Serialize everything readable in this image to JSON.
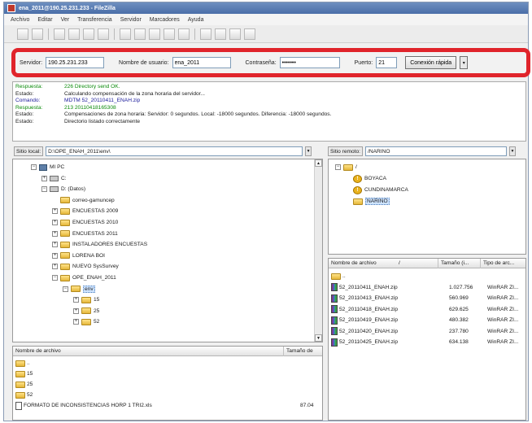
{
  "window": {
    "title": "ena_2011@190.25.231.233 - FileZilla",
    "menu": [
      "Archivo",
      "Editar",
      "Ver",
      "Transferencia",
      "Servidor",
      "Marcadores",
      "Ayuda"
    ]
  },
  "quickconnect": {
    "host_label": "Servidor:",
    "host_value": "190.25.231.233",
    "user_label": "Nombre de usuario:",
    "user_value": "ena_2011",
    "pass_label": "Contraseña:",
    "pass_value": "•••••••",
    "port_label": "Puerto:",
    "port_value": "21",
    "connect_label": "Conexión rápida",
    "dropdown_glyph": "▾"
  },
  "log": [
    {
      "kind": "Respuesta:",
      "text": "226 Directory send OK.",
      "type": "ok"
    },
    {
      "kind": "Estado:",
      "text": "Calculando compensación de la zona horaria del servidor...",
      "type": "status"
    },
    {
      "kind": "Comando:",
      "text": "MDTM 52_20110411_ENAH.zip",
      "type": "cmd"
    },
    {
      "kind": "Respuesta:",
      "text": "213 20110418165308",
      "type": "ok"
    },
    {
      "kind": "Estado:",
      "text": "Compensaciones de zona horaria: Servidor: 0 segundos. Local: -18000 segundos. Diferencia: -18000 segundos.",
      "type": "status"
    },
    {
      "kind": "Estado:",
      "text": "Directorio listado correctamente",
      "type": "status"
    }
  ],
  "local": {
    "path_label": "Sitio local:",
    "path_value": "D:\\OPE_ENAH_2011\\env\\",
    "tree": [
      {
        "label": "MI PC",
        "icon": "pc",
        "indent": 0,
        "expander": "⊟"
      },
      {
        "label": "C:",
        "icon": "drive",
        "indent": 1,
        "expander": "⊞"
      },
      {
        "label": "D: (Datos)",
        "icon": "drive",
        "indent": 1,
        "expander": "⊟"
      },
      {
        "label": "correo-gamuncep",
        "icon": "folder",
        "indent": 2,
        "expander": ""
      },
      {
        "label": "ENCUESTAS 2009",
        "icon": "folder",
        "indent": 2,
        "expander": "⊞"
      },
      {
        "label": "ENCUESTAS 2010",
        "icon": "folder",
        "indent": 2,
        "expander": "⊞"
      },
      {
        "label": "ENCUESTAS 2011",
        "icon": "folder",
        "indent": 2,
        "expander": "⊞"
      },
      {
        "label": "INSTALADORES ENCUESTAS",
        "icon": "folder",
        "indent": 2,
        "expander": "⊞"
      },
      {
        "label": "LORENA BOI",
        "icon": "folder",
        "indent": 2,
        "expander": "⊞"
      },
      {
        "label": "NUEVO SysSurvey",
        "icon": "folder",
        "indent": 2,
        "expander": "⊞"
      },
      {
        "label": "OPE_ENAH_2011",
        "icon": "folder",
        "indent": 2,
        "expander": "⊟"
      },
      {
        "label": "env",
        "icon": "folder",
        "indent": 3,
        "expander": "⊟",
        "selected": true
      },
      {
        "label": "15",
        "icon": "folder",
        "indent": 4,
        "expander": "⊞"
      },
      {
        "label": "25",
        "icon": "folder",
        "indent": 4,
        "expander": "⊞"
      },
      {
        "label": "52",
        "icon": "folder",
        "indent": 4,
        "expander": "⊞"
      }
    ],
    "columns": [
      "Nombre de archivo",
      "Tamaño de"
    ],
    "files": [
      {
        "name": "..",
        "size": "",
        "icon": "folder"
      },
      {
        "name": "15",
        "size": "",
        "icon": "folder"
      },
      {
        "name": "25",
        "size": "",
        "icon": "folder"
      },
      {
        "name": "52",
        "size": "",
        "icon": "folder"
      },
      {
        "name": "FORMATO DE INCONSISTENCIAS HORP 1 TRI2.xls",
        "size": "87.04",
        "icon": "doc"
      }
    ]
  },
  "remote": {
    "path_label": "Sitio remoto:",
    "path_value": "/NARINO",
    "tree": [
      {
        "label": "/",
        "icon": "folder",
        "indent": 0,
        "expander": "⊟"
      },
      {
        "label": "BOYACA",
        "icon": "warn",
        "indent": 1
      },
      {
        "label": "CUNDINAMARCA",
        "icon": "warn",
        "indent": 1
      },
      {
        "label": "NARINO",
        "icon": "folder",
        "indent": 1,
        "selected": true
      }
    ],
    "columns": [
      "Nombre de archivo",
      "/",
      "Tamaño (i...",
      "Tipo de arc..."
    ],
    "files": [
      {
        "name": "..",
        "size": "",
        "type": "",
        "icon": "folder"
      },
      {
        "name": "52_20110411_ENAH.zip",
        "size": "1.027.756",
        "type": "WinRAR ZI...",
        "icon": "zip"
      },
      {
        "name": "52_20110413_ENAH.zip",
        "size": "560.969",
        "type": "WinRAR ZI...",
        "icon": "zip"
      },
      {
        "name": "52_20110418_ENAH.zip",
        "size": "629.625",
        "type": "WinRAR ZI...",
        "icon": "zip"
      },
      {
        "name": "52_20110419_ENAH.zip",
        "size": "480.382",
        "type": "WinRAR ZI...",
        "icon": "zip"
      },
      {
        "name": "52_20110420_ENAH.zip",
        "size": "237.780",
        "type": "WinRAR ZI...",
        "icon": "zip"
      },
      {
        "name": "52_20110425_ENAH.zip",
        "size": "634.138",
        "type": "WinRAR ZI...",
        "icon": "zip"
      }
    ]
  },
  "accent": {
    "highlight_border": "#e0242b",
    "title_bar": "#4a6ea8"
  }
}
